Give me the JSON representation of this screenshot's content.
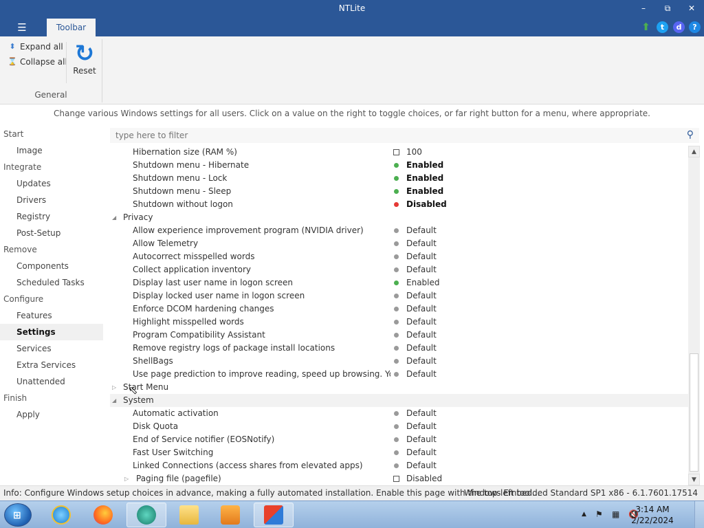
{
  "window": {
    "title": "NTLite",
    "minimize_icon": "minimize-icon",
    "restore_icon": "restore-icon",
    "close_icon": "close-icon"
  },
  "ribbon": {
    "tab_label": "Toolbar",
    "expand_all": "Expand all",
    "collapse_all": "Collapse all",
    "reset": "Reset",
    "group_label": "General",
    "right_icons": [
      "update-arrow-icon",
      "twitter-icon",
      "discord-icon",
      "help-icon"
    ]
  },
  "description": "Change various Windows settings for all users. Click on a value on the right to toggle choices, or far right button for a menu, where appropriate.",
  "sidebar": {
    "items": [
      {
        "label": "Start",
        "type": "section"
      },
      {
        "label": "Image",
        "type": "item"
      },
      {
        "label": "Integrate",
        "type": "section"
      },
      {
        "label": "Updates",
        "type": "item"
      },
      {
        "label": "Drivers",
        "type": "item"
      },
      {
        "label": "Registry",
        "type": "item"
      },
      {
        "label": "Post-Setup",
        "type": "item"
      },
      {
        "label": "Remove",
        "type": "section"
      },
      {
        "label": "Components",
        "type": "item"
      },
      {
        "label": "Scheduled Tasks",
        "type": "item"
      },
      {
        "label": "Configure",
        "type": "section"
      },
      {
        "label": "Features",
        "type": "item"
      },
      {
        "label": "Settings",
        "type": "item",
        "active": true
      },
      {
        "label": "Services",
        "type": "item"
      },
      {
        "label": "Extra Services",
        "type": "item"
      },
      {
        "label": "Unattended",
        "type": "item"
      },
      {
        "label": "Finish",
        "type": "section"
      },
      {
        "label": "Apply",
        "type": "item"
      }
    ]
  },
  "filter": {
    "placeholder": "type here to filter"
  },
  "tree": {
    "rows": [
      {
        "kind": "setting",
        "name": "Hibernation size (RAM %)",
        "marker": "box",
        "value": "100"
      },
      {
        "kind": "setting",
        "name": "Shutdown menu - Hibernate",
        "marker": "green",
        "value": "Enabled",
        "bold": true
      },
      {
        "kind": "setting",
        "name": "Shutdown menu - Lock",
        "marker": "green",
        "value": "Enabled",
        "bold": true
      },
      {
        "kind": "setting",
        "name": "Shutdown menu - Sleep",
        "marker": "green",
        "value": "Enabled",
        "bold": true
      },
      {
        "kind": "setting",
        "name": "Shutdown without logon",
        "marker": "red",
        "value": "Disabled",
        "bold": true
      },
      {
        "kind": "group",
        "name": "Privacy",
        "expanded": true
      },
      {
        "kind": "setting",
        "name": "Allow experience improvement program (NVIDIA driver)",
        "marker": "gray",
        "value": "Default"
      },
      {
        "kind": "setting",
        "name": "Allow Telemetry",
        "marker": "gray",
        "value": "Default"
      },
      {
        "kind": "setting",
        "name": "Autocorrect misspelled words",
        "marker": "gray",
        "value": "Default"
      },
      {
        "kind": "setting",
        "name": "Collect application inventory",
        "marker": "gray",
        "value": "Default"
      },
      {
        "kind": "setting",
        "name": "Display last user name in logon screen",
        "marker": "green",
        "value": "Enabled"
      },
      {
        "kind": "setting",
        "name": "Display locked user name in logon screen",
        "marker": "gray",
        "value": "Default"
      },
      {
        "kind": "setting",
        "name": "Enforce DCOM hardening changes",
        "marker": "gray",
        "value": "Default"
      },
      {
        "kind": "setting",
        "name": "Highlight misspelled words",
        "marker": "gray",
        "value": "Default"
      },
      {
        "kind": "setting",
        "name": "Program Compatibility Assistant",
        "marker": "gray",
        "value": "Default"
      },
      {
        "kind": "setting",
        "name": "Remove registry logs of package install locations",
        "marker": "gray",
        "value": "Default"
      },
      {
        "kind": "setting",
        "name": "ShellBags",
        "marker": "gray",
        "value": "Default"
      },
      {
        "kind": "setting",
        "name": "Use page prediction to improve reading, speed up browsing. Your br...",
        "marker": "gray",
        "value": "Default"
      },
      {
        "kind": "group",
        "name": "Start Menu",
        "expanded": false
      },
      {
        "kind": "group",
        "name": "System",
        "expanded": true,
        "highlight": true
      },
      {
        "kind": "setting",
        "name": "Automatic activation",
        "marker": "gray",
        "value": "Default"
      },
      {
        "kind": "setting",
        "name": "Disk Quota",
        "marker": "gray",
        "value": "Default"
      },
      {
        "kind": "setting",
        "name": "End of Service notifier (EOSNotify)",
        "marker": "gray",
        "value": "Default"
      },
      {
        "kind": "setting",
        "name": "Fast User Switching",
        "marker": "gray",
        "value": "Default"
      },
      {
        "kind": "setting",
        "name": "Linked Connections (access shares from elevated apps)",
        "marker": "gray",
        "value": "Default"
      },
      {
        "kind": "subgroup",
        "name": "Paging file (pagefile)",
        "marker": "box",
        "value": "Disabled"
      }
    ]
  },
  "statusbar": {
    "info": "Info: Configure Windows setup choices in advance, making a fully automated installation. Enable this page with the top-left tool...",
    "os": "Windows Embedded Standard SP1 x86 - 6.1.7601.17514"
  },
  "taskbar": {
    "apps": [
      "internet-explorer-icon",
      "firefox-icon",
      "app-icon",
      "file-explorer-icon",
      "media-player-icon",
      "ntlite-icon"
    ],
    "time": "3:14 AM",
    "date": "2/22/2024"
  }
}
